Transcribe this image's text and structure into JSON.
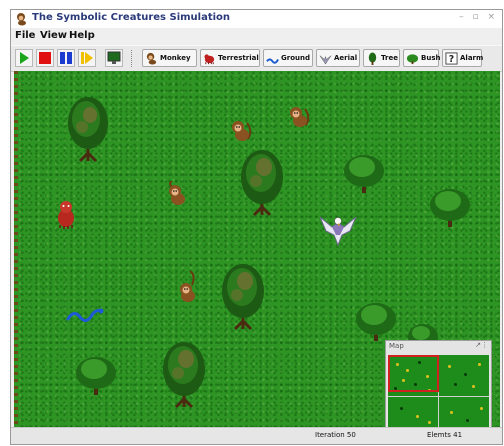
{
  "window": {
    "title": "The Symbolic Creatures Simulation",
    "controls": "– ▫ ×"
  },
  "menu": [
    "File",
    "View",
    "Help"
  ],
  "toolbar": {
    "play_icon": "play-icon",
    "stop_icon": "stop-icon",
    "pause_icon": "pause-icon",
    "step_icon": "step-icon",
    "screen_icon": "monitor-icon",
    "buttons": [
      {
        "label": "Monkey",
        "icon": "monkey-icon"
      },
      {
        "label": "Terrestrial",
        "icon": "terrestrial-predator-icon"
      },
      {
        "label": "Ground",
        "icon": "snake-icon"
      },
      {
        "label": "Aerial",
        "icon": "eagle-icon"
      },
      {
        "label": "Tree",
        "icon": "tree-icon"
      },
      {
        "label": "Bush",
        "icon": "bush-icon"
      },
      {
        "label": "Alarm",
        "icon": "alarm-icon"
      }
    ]
  },
  "colors": {
    "grass": "#2e9424",
    "minimap_grass": "#1e8c1a",
    "minimap_viewport": "#d02020",
    "play": "#1aa51a",
    "stop": "#e01010",
    "pause": "#1a3ad0",
    "step": "#f0c000"
  },
  "minimap": {
    "title": "Map",
    "controls": "↗⋮"
  },
  "status": {
    "iteration": "Iteration 50",
    "elements": "Elemts 41"
  }
}
